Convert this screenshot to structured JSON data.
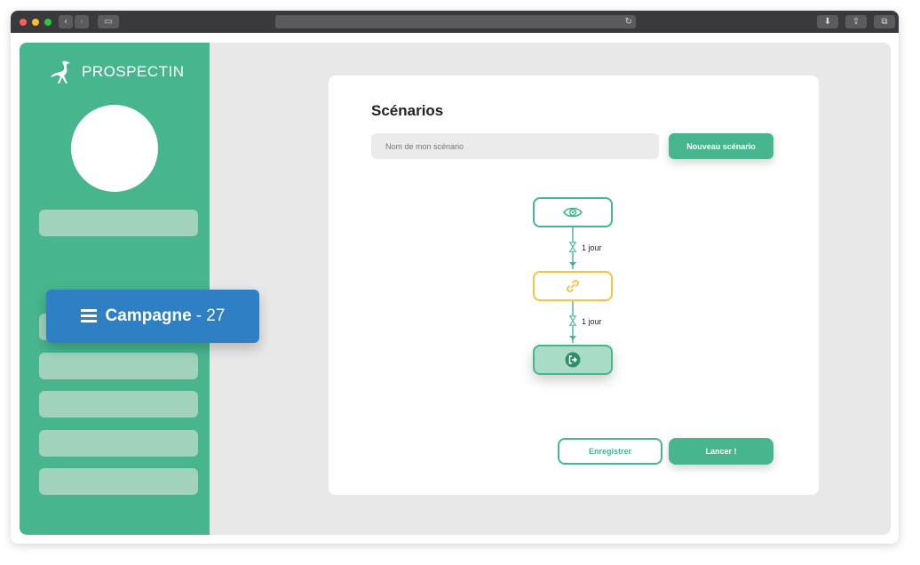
{
  "colors": {
    "brand_green": "#47b68f",
    "menu_placeholder": "#a0d2bc",
    "active_blue": "#2e7fc3",
    "link_step_yellow": "#f2c448",
    "background_gray": "#e8e8e8"
  },
  "sidebar": {
    "logo_text": "PROSPECTIN",
    "logo_icon": "ostrich-logo-icon",
    "active_item": {
      "icon": "hamburger-menu-icon",
      "label": "Campagne",
      "count": "- 27"
    }
  },
  "main": {
    "title": "Scénarios",
    "name_input_placeholder": "Nom de mon scénario",
    "new_button_label": "Nouveau scénario",
    "steps": [
      {
        "icon": "eye-icon",
        "kind": "visit"
      },
      {
        "icon": "link-icon",
        "kind": "connect"
      },
      {
        "icon": "exit-icon",
        "kind": "end"
      }
    ],
    "delays": [
      "1 jour",
      "1 jour"
    ],
    "delay_icon": "hourglass-icon",
    "save_button_label": "Enregistrer",
    "launch_button_label": "Lancer !"
  }
}
